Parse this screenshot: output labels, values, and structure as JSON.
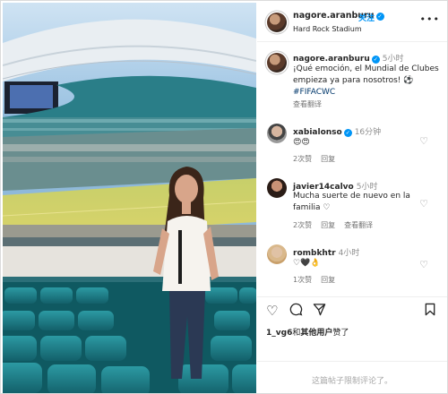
{
  "post": {
    "username": "nagore.aranburu",
    "follow_label": "关注",
    "location": "Hard Rock Stadium",
    "more_icon": "more-horizontal-icon",
    "caption": {
      "time": "5小时",
      "text": "¡Qué emoción, el Mundial de Clubes empieza ya para nosotros! ⚽",
      "hashtag": "#FIFACWC",
      "translate_label": "查看翻译"
    }
  },
  "comments": [
    {
      "username": "xabialonso",
      "verified": true,
      "time": "16分钟",
      "text": "😍😍",
      "likes": "2次赞",
      "reply": "回复",
      "translate": ""
    },
    {
      "username": "javier14calvo",
      "verified": false,
      "time": "5小时",
      "text": "Mucha suerte de nuevo en la familia ♡",
      "likes": "2次赞",
      "reply": "回复",
      "translate": "查看翻译"
    },
    {
      "username": "rombkhtr",
      "verified": false,
      "time": "4小时",
      "text": "♡🖤👌",
      "likes": "1次赞",
      "reply": "回复",
      "translate": ""
    }
  ],
  "actions": {
    "like_icon": "heart-icon",
    "comment_icon": "comment-icon",
    "share_icon": "share-icon",
    "save_icon": "bookmark-icon"
  },
  "likes_line": {
    "user": "1_vg6",
    "connector": "和",
    "others": "其他用户",
    "suffix": "赞了"
  },
  "comments_limited": "这篇帖子限制评论了。",
  "colors": {
    "accent": "#0095f6",
    "verified": "#0095f6",
    "muted": "#8e8e8e"
  }
}
